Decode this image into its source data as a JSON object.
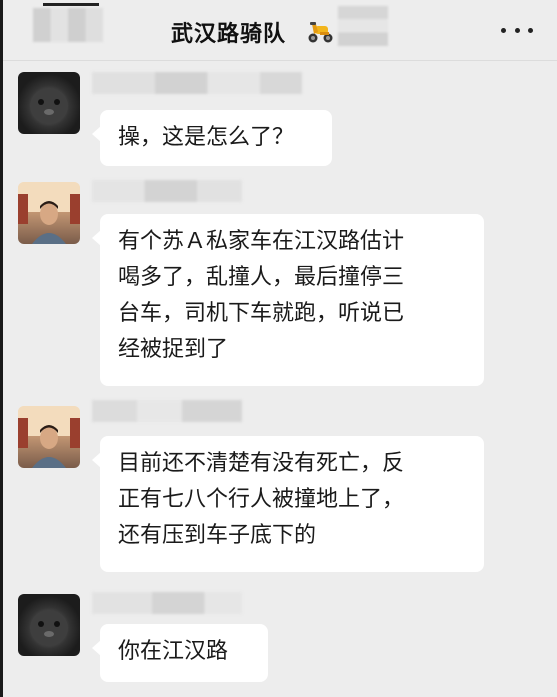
{
  "chat": {
    "title": "武汉路骑队"
  },
  "messages": [
    {
      "sender": "cat-avatar",
      "text": "操，这是怎么了？"
    },
    {
      "sender": "person-avatar",
      "lines": [
        "有个苏Ａ私家车在江汉路估计",
        "喝多了，乱撞人，最后撞停三",
        "台车，司机下车就跑，听说已",
        "经被捉到了"
      ]
    },
    {
      "sender": "person-avatar",
      "lines": [
        "目前还不清楚有没有死亡，反",
        "正有七八个行人被撞地上了，",
        "还有压到车子底下的"
      ]
    },
    {
      "sender": "cat-avatar",
      "text": "你在江汉路"
    }
  ],
  "icons": {
    "title_emoji": "scooter-icon",
    "menu": "more-icon"
  },
  "colors": {
    "background": "#ededed",
    "bubble": "#ffffff",
    "text": "#1a1a1a"
  }
}
